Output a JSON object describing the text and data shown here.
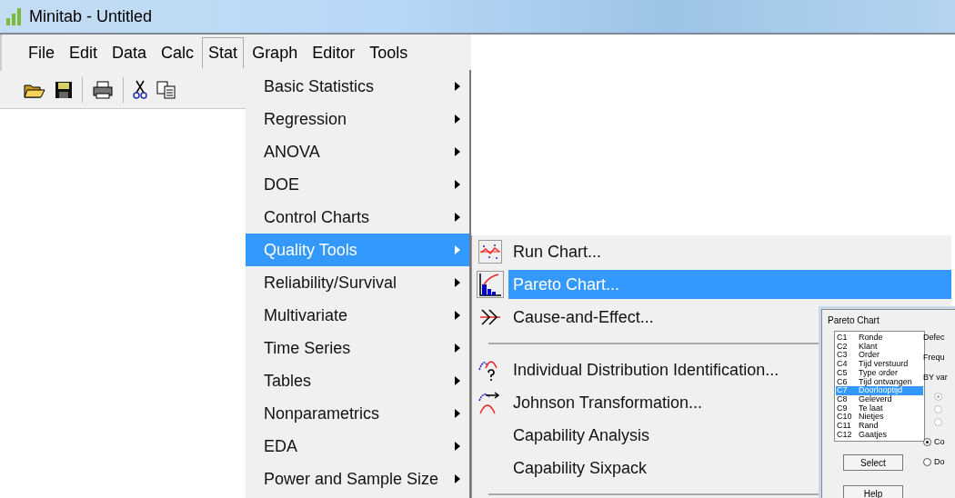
{
  "window": {
    "title": "Minitab - Untitled"
  },
  "menubar": [
    {
      "label": "File",
      "selected": false
    },
    {
      "label": "Edit",
      "selected": false
    },
    {
      "label": "Data",
      "selected": false
    },
    {
      "label": "Calc",
      "selected": false
    },
    {
      "label": "Stat",
      "selected": true
    },
    {
      "label": "Graph",
      "selected": false
    },
    {
      "label": "Editor",
      "selected": false
    },
    {
      "label": "Tools",
      "selected": false
    }
  ],
  "stat_menu": [
    {
      "label": "Basic Statistics",
      "selected": false
    },
    {
      "label": "Regression",
      "selected": false
    },
    {
      "label": "ANOVA",
      "selected": false
    },
    {
      "label": "DOE",
      "selected": false
    },
    {
      "label": "Control Charts",
      "selected": false
    },
    {
      "label": "Quality Tools",
      "selected": true
    },
    {
      "label": "Reliability/Survival",
      "selected": false
    },
    {
      "label": "Multivariate",
      "selected": false
    },
    {
      "label": "Time Series",
      "selected": false
    },
    {
      "label": "Tables",
      "selected": false
    },
    {
      "label": "Nonparametrics",
      "selected": false
    },
    {
      "label": "EDA",
      "selected": false
    },
    {
      "label": "Power and Sample Size",
      "selected": false
    }
  ],
  "quality_tools_menu": [
    {
      "kind": "item",
      "label": "Run Chart...",
      "selected": false
    },
    {
      "kind": "item",
      "label": "Pareto Chart...",
      "selected": true
    },
    {
      "kind": "item",
      "label": "Cause-and-Effect...",
      "selected": false
    },
    {
      "kind": "separator"
    },
    {
      "kind": "item",
      "label": "Individual Distribution Identification...",
      "selected": false
    },
    {
      "kind": "item",
      "label": "Johnson Transformation...",
      "selected": false
    },
    {
      "kind": "item",
      "label": "Capability Analysis",
      "selected": false
    },
    {
      "kind": "item",
      "label": "Capability Sixpack",
      "selected": false
    },
    {
      "kind": "separator"
    }
  ],
  "dialog": {
    "title": "Pareto Chart",
    "columns": [
      {
        "id": "C1",
        "name": "Ronde",
        "selected": false
      },
      {
        "id": "C2",
        "name": "Klant",
        "selected": false
      },
      {
        "id": "C3",
        "name": "Order",
        "selected": false
      },
      {
        "id": "C4",
        "name": "Tijd verstuurd",
        "selected": false
      },
      {
        "id": "C5",
        "name": "Type order",
        "selected": false
      },
      {
        "id": "C6",
        "name": "Tijd ontvangen",
        "selected": false
      },
      {
        "id": "C7",
        "name": "Doorlooptijd",
        "selected": true
      },
      {
        "id": "C8",
        "name": "Geleverd",
        "selected": false
      },
      {
        "id": "C9",
        "name": "Te laat",
        "selected": false
      },
      {
        "id": "C10",
        "name": "Nietjes",
        "selected": false
      },
      {
        "id": "C11",
        "name": "Rand",
        "selected": false
      },
      {
        "id": "C12",
        "name": "Gaatjes",
        "selected": false
      }
    ],
    "field_labels": [
      "Defec",
      "Frequ",
      "BY var"
    ],
    "sub_options": [
      {
        "checked": true,
        "disabled": true
      },
      {
        "checked": false,
        "disabled": true
      },
      {
        "checked": false,
        "disabled": true
      }
    ],
    "options": [
      {
        "label": "Co",
        "checked": true
      },
      {
        "label": "Do",
        "checked": false
      }
    ],
    "buttons": [
      "Select",
      "Help"
    ]
  }
}
